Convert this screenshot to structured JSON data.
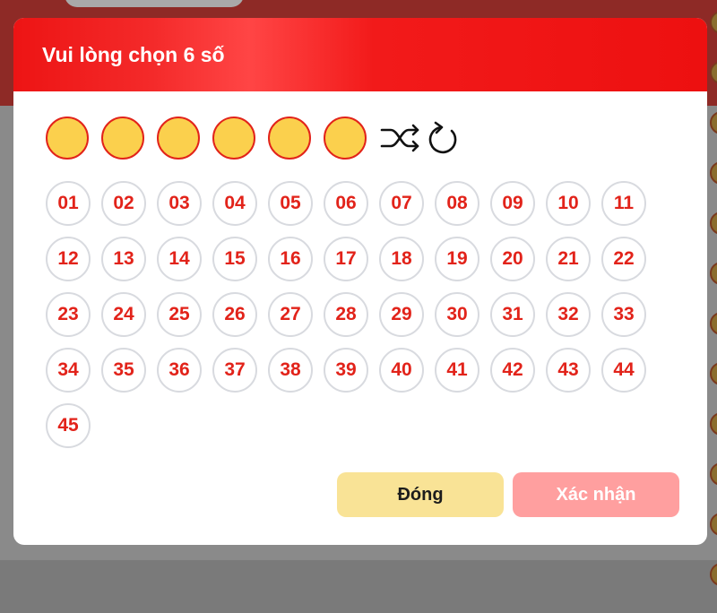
{
  "modal": {
    "title": "Vui lòng chọn 6 số",
    "selected_slots": [
      "",
      "",
      "",
      "",
      "",
      ""
    ],
    "tools": {
      "shuffle_icon": "shuffle-icon",
      "reset_icon": "refresh-icon"
    },
    "numbers": [
      "01",
      "02",
      "03",
      "04",
      "05",
      "06",
      "07",
      "08",
      "09",
      "10",
      "11",
      "12",
      "13",
      "14",
      "15",
      "16",
      "17",
      "18",
      "19",
      "20",
      "21",
      "22",
      "23",
      "24",
      "25",
      "26",
      "27",
      "28",
      "29",
      "30",
      "31",
      "32",
      "33",
      "34",
      "35",
      "36",
      "37",
      "38",
      "39",
      "40",
      "41",
      "42",
      "43",
      "44",
      "45"
    ],
    "buttons": {
      "close_label": "Đóng",
      "confirm_label": "Xác nhận"
    }
  },
  "colors": {
    "header_red": "#ed1414",
    "number_red": "#e2231a",
    "slot_yellow": "#fbd04d",
    "close_button": "#f9e396",
    "confirm_button": "#ff9f9f"
  }
}
